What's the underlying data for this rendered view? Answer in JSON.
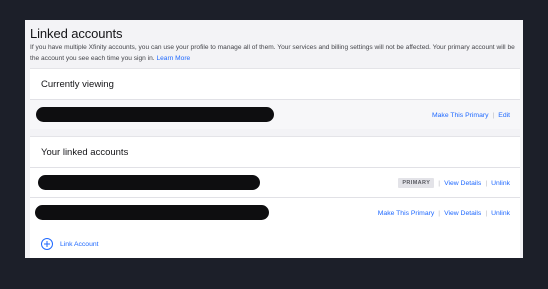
{
  "page": {
    "title": "Linked accounts",
    "description": "If you have multiple Xfinity accounts, you can use your profile to manage all of them. Your services and billing settings will not be affected. Your primary account will be the account you see each time you sign in.",
    "learn_more": "Learn More"
  },
  "current": {
    "title": "Currently viewing",
    "actions": {
      "make_primary": "Make This Primary",
      "edit": "Edit"
    }
  },
  "linked": {
    "title": "Your linked accounts",
    "rows": [
      {
        "badge": "PRIMARY",
        "view": "View Details",
        "unlink": "Unlink"
      },
      {
        "make_primary": "Make This Primary",
        "view": "View Details",
        "unlink": "Unlink"
      }
    ],
    "add_label": "Link Account"
  },
  "colors": {
    "accent": "#1f69ff",
    "background": "#1c1f29",
    "panel": "#f3f3f6",
    "redaction": "#0e0e10"
  }
}
